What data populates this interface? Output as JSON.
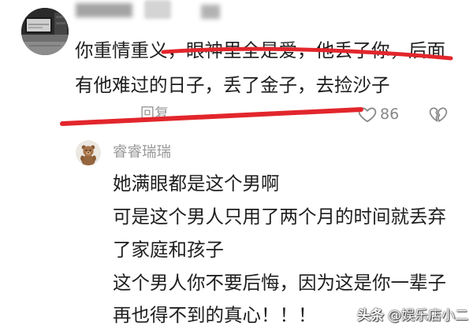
{
  "comment": {
    "avatar_icon": "user-avatar-photo",
    "username_state": "obscured",
    "text_lines": [
      "你重情重义，眼神里全是爱，他丢了你，后面",
      "有他难过的日子，丢了金子，去捡沙子"
    ],
    "reply_label": "回复",
    "like_icon": "heart-outline-icon",
    "like_count": "86",
    "dislike_icon": "broken-heart-icon"
  },
  "reply": {
    "avatar_icon": "teddy-bear-avatar",
    "username": "睿睿瑞瑞",
    "text_lines": [
      "她满眼都是这个男啊",
      "可是这个男人只用了两个月的时间就丢弃",
      "了家庭和孩子",
      "这个男人你不要后悔，因为这是你一辈子",
      "再也得不到的真心！！！"
    ]
  },
  "watermark": {
    "platform": "头条",
    "handle": "@娱乐店小二"
  },
  "colors": {
    "background": "#ffffff",
    "text": "#1e1e1e",
    "secondary_text": "#999999",
    "icon_gray": "#8a8a8a",
    "annotation_red": "#e2262c"
  }
}
